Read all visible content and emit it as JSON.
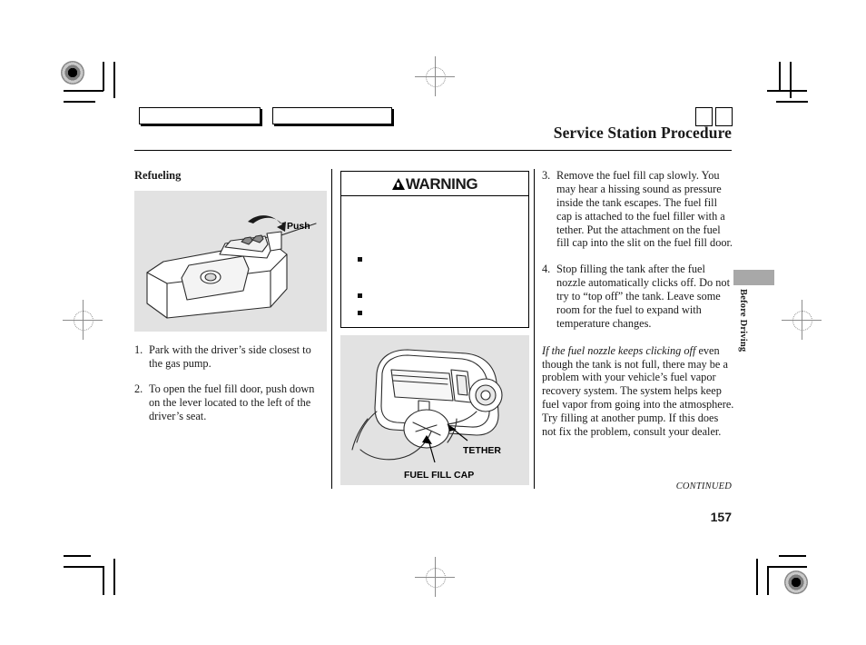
{
  "document": {
    "title": "Service Station Procedure",
    "page_number": "157",
    "continued_label": "CONTINUED",
    "side_tab_label": "Before Driving"
  },
  "column_left": {
    "section_heading": "Refueling",
    "figure": {
      "name": "fuel-door-release-lever-illustration",
      "labels": {
        "push": "Push"
      }
    },
    "steps": [
      {
        "num": "1.",
        "text": "Park with the driver’s side closest to the gas pump."
      },
      {
        "num": "2.",
        "text": "To open the fuel fill door, push down on the lever located to the left of the driver’s seat."
      }
    ]
  },
  "column_middle": {
    "warning": {
      "icon": "warning-triangle-icon",
      "heading": "WARNING",
      "bullets": [
        "",
        "",
        ""
      ]
    },
    "figure": {
      "name": "fuel-fill-cap-tether-illustration",
      "labels": {
        "tether": "TETHER",
        "fuel_fill_cap": "FUEL FILL CAP"
      }
    }
  },
  "column_right": {
    "steps": [
      {
        "num": "3.",
        "text": "Remove the fuel fill cap slowly. You may hear a hissing sound as pressure inside the tank escapes. The fuel fill cap is attached to the fuel filler with a tether. Put the attachment on the fuel fill cap into the slit on the fuel fill door."
      },
      {
        "num": "4.",
        "text": "Stop filling the tank after the fuel nozzle automatically clicks off. Do not try to “top off” the tank. Leave some room for the fuel to expand with temperature changes."
      }
    ],
    "note": {
      "italic_lead": "If the fuel nozzle keeps clicking off",
      "rest": " even though the tank is not full, there may be a problem with your vehicle’s fuel vapor recovery system. The system helps keep fuel vapor from going into the atmosphere. Try filling at another pump. If this does not fix the problem, consult your dealer."
    }
  },
  "colors": {
    "figure_background": "#e2e2e2",
    "side_tab": "#a8a8a8",
    "text": "#1a1a1a"
  }
}
